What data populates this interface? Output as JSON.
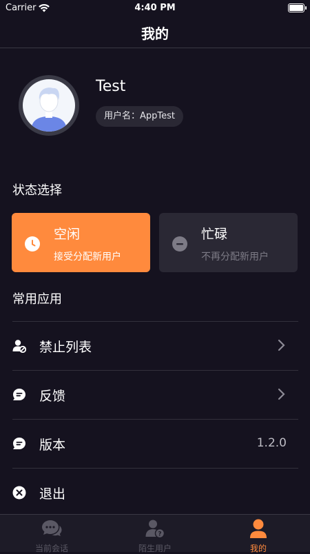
{
  "status_bar": {
    "carrier": "Carrier",
    "time": "4:40 PM"
  },
  "nav": {
    "title": "我的"
  },
  "profile": {
    "name": "Test",
    "username_label": "用户名：AppTest"
  },
  "status_section": {
    "title": "状态选择",
    "options": [
      {
        "label": "空闲",
        "desc": "接受分配新用户",
        "selected": true,
        "color": "#ff8a3d"
      },
      {
        "label": "忙碌",
        "desc": "不再分配新用户",
        "selected": false,
        "color": "#2a2834"
      }
    ]
  },
  "apps_section": {
    "title": "常用应用",
    "items": [
      {
        "label": "禁止列表",
        "icon": "block-user-icon",
        "chevron": true
      },
      {
        "label": "反馈",
        "icon": "feedback-icon",
        "chevron": true
      },
      {
        "label": "版本",
        "icon": "version-icon",
        "value": "1.2.0"
      },
      {
        "label": "退出",
        "icon": "logout-icon"
      }
    ]
  },
  "tabbar": {
    "tabs": [
      {
        "label": "当前会话",
        "icon": "chat-icon",
        "active": false
      },
      {
        "label": "陌生用户",
        "icon": "unknown-user-icon",
        "active": false
      },
      {
        "label": "我的",
        "icon": "profile-icon",
        "active": true
      }
    ],
    "active_color": "#ff8a3d",
    "inactive_color": "#5a5864"
  }
}
